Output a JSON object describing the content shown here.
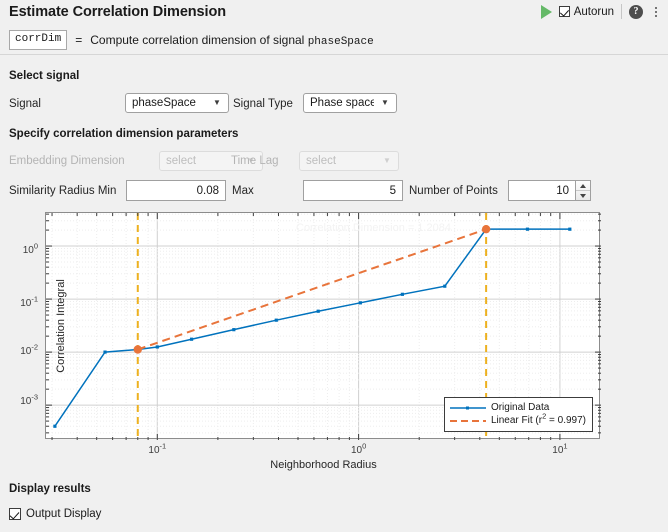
{
  "header": {
    "title": "Estimate Correlation Dimension",
    "autorun_label": "Autorun",
    "autorun_checked": "true",
    "run_icon": "play-icon",
    "help_icon": "help-icon",
    "help_glyph": "?",
    "more_icon": "more-options-icon"
  },
  "signature": {
    "output_var": "corrDim",
    "equals": "=",
    "description_prefix": "Compute correlation dimension of signal ",
    "description_var": "phaseSpace"
  },
  "select_signal": {
    "section_label": "Select signal",
    "signal_label": "Signal",
    "signal_value": "phaseSpace",
    "signal_type_label": "Signal Type",
    "signal_type_value": "Phase space"
  },
  "parameters": {
    "section_label": "Specify correlation dimension parameters",
    "embedding_dimension_label": "Embedding Dimension",
    "embedding_dimension_value": "select",
    "embedding_dimension_disabled": "true",
    "time_lag_label": "Time Lag",
    "time_lag_value": "select",
    "time_lag_disabled": "true",
    "similarity_radius_min_label": "Similarity Radius Min",
    "similarity_radius_min_value": "0.08",
    "max_label": "Max",
    "max_value": "5",
    "number_of_points_label": "Number of Points",
    "number_of_points_value": "10"
  },
  "display_results": {
    "section_label": "Display results",
    "output_display_label": "Output Display",
    "output_display_checked": "true"
  },
  "chart_data": {
    "type": "line",
    "title": "Correlation Dimension = 1.2084",
    "xlabel": "Neighborhood Radius",
    "ylabel": "Correlation Integral",
    "xscale": "log",
    "yscale": "log",
    "xlim": [
      0.028,
      16.0
    ],
    "ylim": [
      0.00022,
      4.2
    ],
    "xticks": [
      0.1,
      1,
      10
    ],
    "xtick_labels": [
      "10⁻¹",
      "10⁰",
      "10¹"
    ],
    "yticks": [
      0.001,
      0.01,
      0.1,
      1
    ],
    "ytick_labels": [
      "10⁻³",
      "10⁻²",
      "10⁻¹",
      "10⁰"
    ],
    "grid": "minor-log",
    "legend_position": "lower right",
    "series": [
      {
        "name": "Original Data",
        "color": "#0072bd",
        "style": "solid-with-markers",
        "x": [
          0.031,
          0.055,
          0.08,
          0.1,
          0.148,
          0.24,
          0.39,
          0.63,
          1.02,
          1.65,
          2.68,
          4.3,
          6.9,
          11.2
        ],
        "y": [
          0.0004,
          0.01,
          0.0112,
          0.0125,
          0.0175,
          0.0265,
          0.04,
          0.059,
          0.085,
          0.123,
          0.175,
          2.08,
          2.08,
          2.08
        ]
      },
      {
        "name": "Linear Fit (r² = 0.997)",
        "color": "#e8743b",
        "style": "dashed",
        "r_squared": 0.997,
        "x": [
          0.08,
          4.3
        ],
        "y": [
          0.0112,
          2.08
        ]
      }
    ],
    "markers": [
      {
        "name": "fit-range-min",
        "x": 0.08,
        "y": 0.0112,
        "color": "#e8743b"
      },
      {
        "name": "fit-range-max",
        "x": 4.3,
        "y": 2.08,
        "color": "#e8743b"
      }
    ],
    "vertical_rules": [
      {
        "name": "similarity-radius-min-rule",
        "x": 0.08,
        "color": "#edb120"
      },
      {
        "name": "similarity-radius-max-rule",
        "x": 4.3,
        "color": "#edb120"
      }
    ],
    "legend": [
      {
        "label": "Original Data",
        "color": "#0072bd",
        "style": "solid-with-markers"
      },
      {
        "label": "Linear Fit (r",
        "sup": "2",
        "label_tail": " = 0.997)",
        "color": "#e8743b",
        "style": "dashed"
      }
    ]
  },
  "legend_text": {
    "original_data": "Original Data",
    "linear_fit_pre": "Linear Fit (r",
    "linear_fit_sup": "2",
    "linear_fit_post": " = 0.997)"
  },
  "axis_text": {
    "y_t0": "10",
    "y_s0": "0",
    "y_t1": "10",
    "y_s1": "-1",
    "y_t2": "10",
    "y_s2": "-2",
    "y_t3": "10",
    "y_s3": "-3",
    "x_t0": "10",
    "x_s0": "-1",
    "x_t1": "10",
    "x_s1": "0",
    "x_t2": "10",
    "x_s2": "1"
  }
}
